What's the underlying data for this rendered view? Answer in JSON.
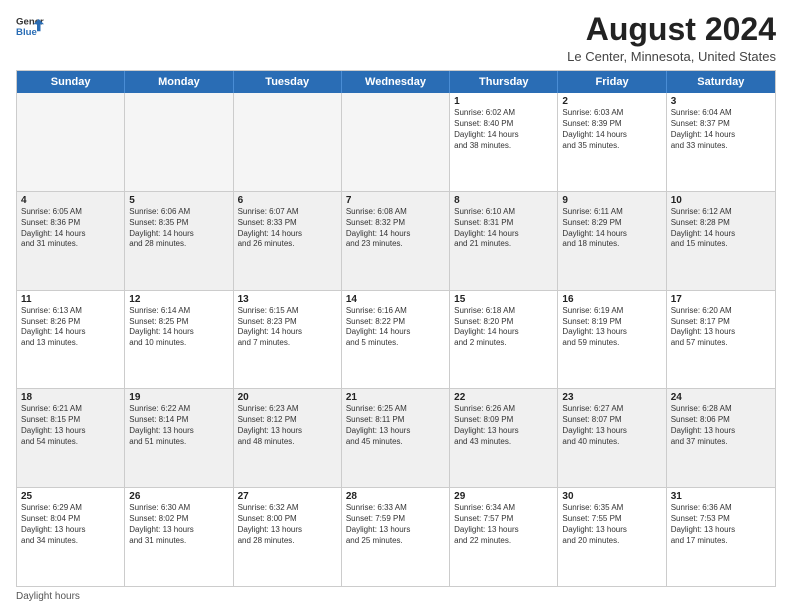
{
  "logo": {
    "line1": "General",
    "line2": "Blue"
  },
  "title": "August 2024",
  "subtitle": "Le Center, Minnesota, United States",
  "days_of_week": [
    "Sunday",
    "Monday",
    "Tuesday",
    "Wednesday",
    "Thursday",
    "Friday",
    "Saturday"
  ],
  "footer": "Daylight hours",
  "weeks": [
    [
      {
        "day": "",
        "info": "",
        "empty": true
      },
      {
        "day": "",
        "info": "",
        "empty": true
      },
      {
        "day": "",
        "info": "",
        "empty": true
      },
      {
        "day": "",
        "info": "",
        "empty": true
      },
      {
        "day": "1",
        "info": "Sunrise: 6:02 AM\nSunset: 8:40 PM\nDaylight: 14 hours\nand 38 minutes."
      },
      {
        "day": "2",
        "info": "Sunrise: 6:03 AM\nSunset: 8:39 PM\nDaylight: 14 hours\nand 35 minutes."
      },
      {
        "day": "3",
        "info": "Sunrise: 6:04 AM\nSunset: 8:37 PM\nDaylight: 14 hours\nand 33 minutes."
      }
    ],
    [
      {
        "day": "4",
        "info": "Sunrise: 6:05 AM\nSunset: 8:36 PM\nDaylight: 14 hours\nand 31 minutes."
      },
      {
        "day": "5",
        "info": "Sunrise: 6:06 AM\nSunset: 8:35 PM\nDaylight: 14 hours\nand 28 minutes."
      },
      {
        "day": "6",
        "info": "Sunrise: 6:07 AM\nSunset: 8:33 PM\nDaylight: 14 hours\nand 26 minutes."
      },
      {
        "day": "7",
        "info": "Sunrise: 6:08 AM\nSunset: 8:32 PM\nDaylight: 14 hours\nand 23 minutes."
      },
      {
        "day": "8",
        "info": "Sunrise: 6:10 AM\nSunset: 8:31 PM\nDaylight: 14 hours\nand 21 minutes."
      },
      {
        "day": "9",
        "info": "Sunrise: 6:11 AM\nSunset: 8:29 PM\nDaylight: 14 hours\nand 18 minutes."
      },
      {
        "day": "10",
        "info": "Sunrise: 6:12 AM\nSunset: 8:28 PM\nDaylight: 14 hours\nand 15 minutes."
      }
    ],
    [
      {
        "day": "11",
        "info": "Sunrise: 6:13 AM\nSunset: 8:26 PM\nDaylight: 14 hours\nand 13 minutes."
      },
      {
        "day": "12",
        "info": "Sunrise: 6:14 AM\nSunset: 8:25 PM\nDaylight: 14 hours\nand 10 minutes."
      },
      {
        "day": "13",
        "info": "Sunrise: 6:15 AM\nSunset: 8:23 PM\nDaylight: 14 hours\nand 7 minutes."
      },
      {
        "day": "14",
        "info": "Sunrise: 6:16 AM\nSunset: 8:22 PM\nDaylight: 14 hours\nand 5 minutes."
      },
      {
        "day": "15",
        "info": "Sunrise: 6:18 AM\nSunset: 8:20 PM\nDaylight: 14 hours\nand 2 minutes."
      },
      {
        "day": "16",
        "info": "Sunrise: 6:19 AM\nSunset: 8:19 PM\nDaylight: 13 hours\nand 59 minutes."
      },
      {
        "day": "17",
        "info": "Sunrise: 6:20 AM\nSunset: 8:17 PM\nDaylight: 13 hours\nand 57 minutes."
      }
    ],
    [
      {
        "day": "18",
        "info": "Sunrise: 6:21 AM\nSunset: 8:15 PM\nDaylight: 13 hours\nand 54 minutes."
      },
      {
        "day": "19",
        "info": "Sunrise: 6:22 AM\nSunset: 8:14 PM\nDaylight: 13 hours\nand 51 minutes."
      },
      {
        "day": "20",
        "info": "Sunrise: 6:23 AM\nSunset: 8:12 PM\nDaylight: 13 hours\nand 48 minutes."
      },
      {
        "day": "21",
        "info": "Sunrise: 6:25 AM\nSunset: 8:11 PM\nDaylight: 13 hours\nand 45 minutes."
      },
      {
        "day": "22",
        "info": "Sunrise: 6:26 AM\nSunset: 8:09 PM\nDaylight: 13 hours\nand 43 minutes."
      },
      {
        "day": "23",
        "info": "Sunrise: 6:27 AM\nSunset: 8:07 PM\nDaylight: 13 hours\nand 40 minutes."
      },
      {
        "day": "24",
        "info": "Sunrise: 6:28 AM\nSunset: 8:06 PM\nDaylight: 13 hours\nand 37 minutes."
      }
    ],
    [
      {
        "day": "25",
        "info": "Sunrise: 6:29 AM\nSunset: 8:04 PM\nDaylight: 13 hours\nand 34 minutes."
      },
      {
        "day": "26",
        "info": "Sunrise: 6:30 AM\nSunset: 8:02 PM\nDaylight: 13 hours\nand 31 minutes."
      },
      {
        "day": "27",
        "info": "Sunrise: 6:32 AM\nSunset: 8:00 PM\nDaylight: 13 hours\nand 28 minutes."
      },
      {
        "day": "28",
        "info": "Sunrise: 6:33 AM\nSunset: 7:59 PM\nDaylight: 13 hours\nand 25 minutes."
      },
      {
        "day": "29",
        "info": "Sunrise: 6:34 AM\nSunset: 7:57 PM\nDaylight: 13 hours\nand 22 minutes."
      },
      {
        "day": "30",
        "info": "Sunrise: 6:35 AM\nSunset: 7:55 PM\nDaylight: 13 hours\nand 20 minutes."
      },
      {
        "day": "31",
        "info": "Sunrise: 6:36 AM\nSunset: 7:53 PM\nDaylight: 13 hours\nand 17 minutes."
      }
    ]
  ]
}
